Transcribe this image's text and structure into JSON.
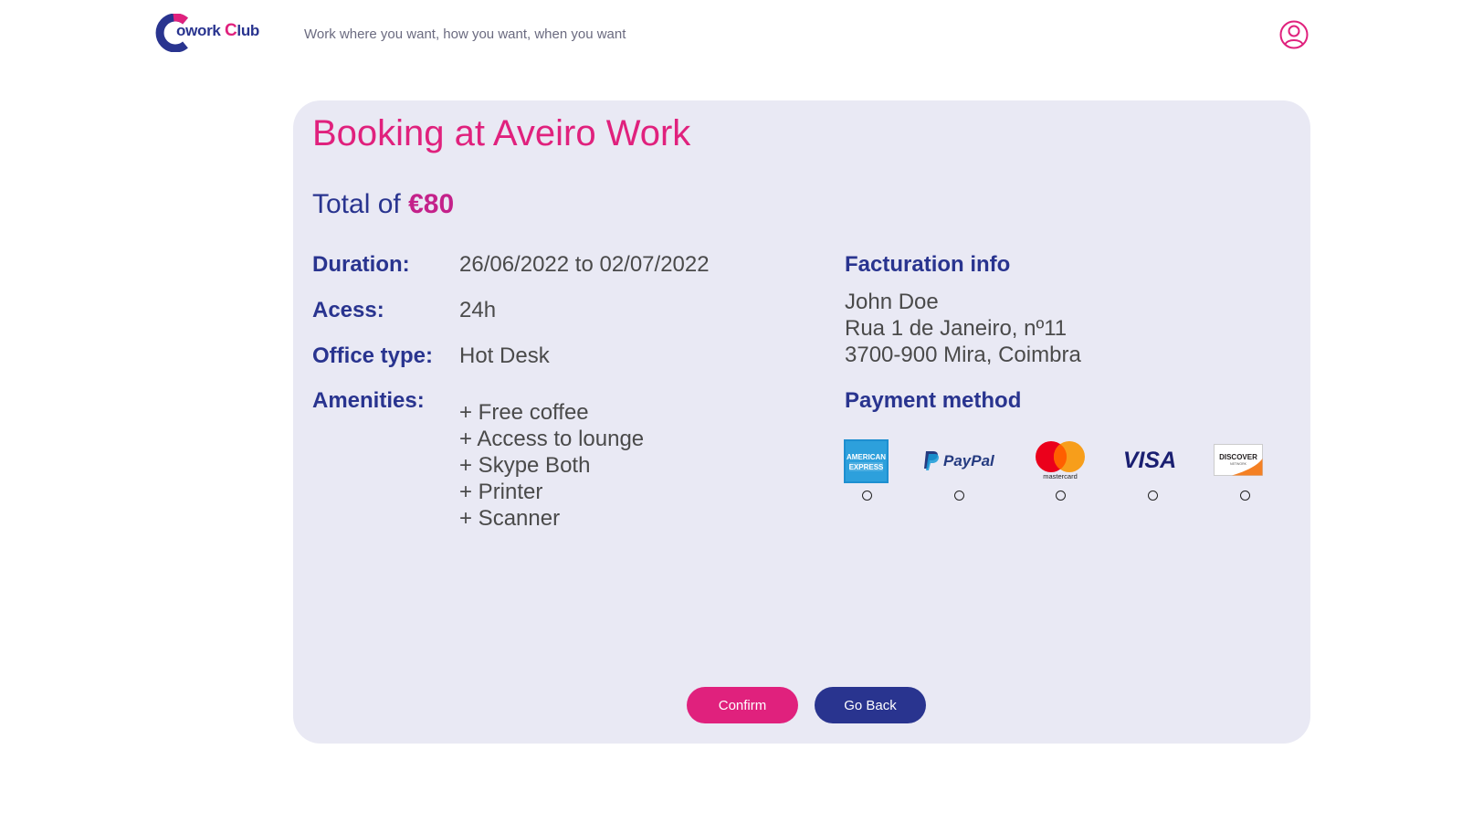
{
  "header": {
    "logo": {
      "first": "C",
      "rest": "owork",
      "club_first": "C",
      "club_rest": "lub"
    },
    "tagline": "Work where you want, how you want, when you want"
  },
  "booking": {
    "title": "Booking at Aveiro Work",
    "total_prefix": "Total of",
    "total_amount": "€80",
    "duration_label": "Duration:",
    "duration_value": "26/06/2022 to 02/07/2022",
    "access_label": "Acess:",
    "access_value": "24h",
    "office_label": "Office type:",
    "office_value": "Hot Desk",
    "amenities_label": "Amenities:",
    "amenities": [
      "+ Free coffee",
      "+ Access to lounge",
      "+ Skype Both",
      "+ Printer",
      "+ Scanner"
    ]
  },
  "facturation": {
    "title": "Facturation info",
    "name": "John Doe",
    "street": "Rua 1 de Janeiro, nº11",
    "city": "3700-900 Mira, Coimbra"
  },
  "payment": {
    "title": "Payment method",
    "methods": [
      {
        "id": "amex",
        "line1": "AMERICAN",
        "line2": "EXPRESS"
      },
      {
        "id": "paypal",
        "text": "PayPal"
      },
      {
        "id": "mastercard",
        "text": "mastercard"
      },
      {
        "id": "visa",
        "text": "VISA"
      },
      {
        "id": "discover",
        "text": "DISCOVER",
        "sub": "NETWORK"
      }
    ]
  },
  "actions": {
    "confirm": "Confirm",
    "back": "Go Back"
  },
  "colors": {
    "primary_pink": "#e0217d",
    "primary_navy": "#29348f",
    "card_background": "#e9e9f4"
  }
}
